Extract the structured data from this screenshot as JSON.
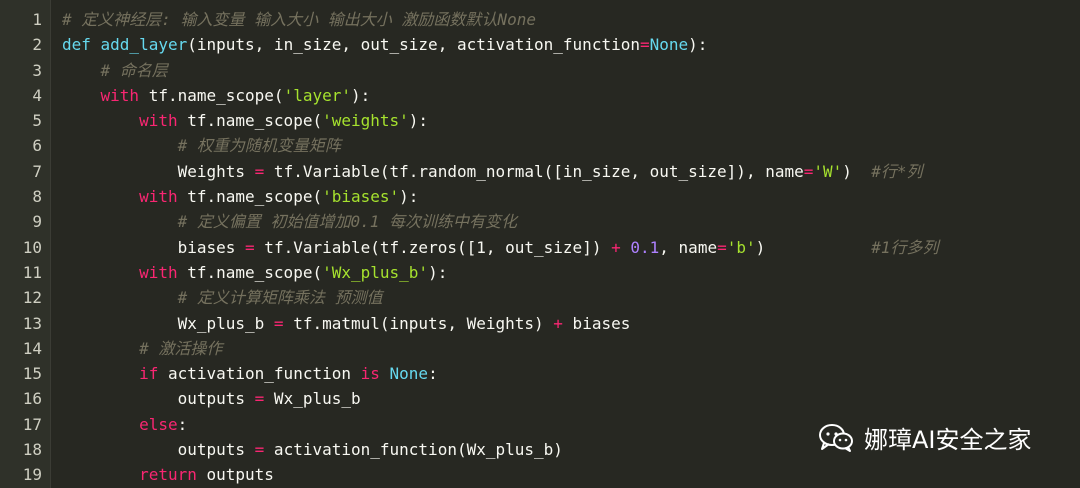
{
  "lines": [
    {
      "n": "1",
      "tokens": [
        {
          "c": "cmt",
          "t": "# 定义神经层: 输入变量 输入大小 输出大小 激励函数默认None"
        }
      ]
    },
    {
      "n": "2",
      "tokens": [
        {
          "c": "kw2",
          "t": "def "
        },
        {
          "c": "fn",
          "t": "add_layer"
        },
        {
          "c": "",
          "t": "(inputs, in_size, out_size, activation_function"
        },
        {
          "c": "op",
          "t": "="
        },
        {
          "c": "cst",
          "t": "None"
        },
        {
          "c": "",
          "t": "):"
        }
      ]
    },
    {
      "n": "3",
      "tokens": [
        {
          "c": "",
          "t": "    "
        },
        {
          "c": "cmt",
          "t": "# 命名层"
        }
      ]
    },
    {
      "n": "4",
      "tokens": [
        {
          "c": "",
          "t": "    "
        },
        {
          "c": "kw",
          "t": "with"
        },
        {
          "c": "",
          "t": " tf.name_scope("
        },
        {
          "c": "str",
          "t": "'layer'"
        },
        {
          "c": "",
          "t": "):"
        }
      ]
    },
    {
      "n": "5",
      "tokens": [
        {
          "c": "",
          "t": "        "
        },
        {
          "c": "kw",
          "t": "with"
        },
        {
          "c": "",
          "t": " tf.name_scope("
        },
        {
          "c": "str",
          "t": "'weights'"
        },
        {
          "c": "",
          "t": "):"
        }
      ]
    },
    {
      "n": "6",
      "tokens": [
        {
          "c": "",
          "t": "            "
        },
        {
          "c": "cmt",
          "t": "# 权重为随机变量矩阵"
        }
      ]
    },
    {
      "n": "7",
      "tokens": [
        {
          "c": "",
          "t": "            Weights "
        },
        {
          "c": "op",
          "t": "="
        },
        {
          "c": "",
          "t": " tf.Variable(tf.random_normal([in_size, out_size]), name"
        },
        {
          "c": "op",
          "t": "="
        },
        {
          "c": "str",
          "t": "'W'"
        },
        {
          "c": "",
          "t": ")  "
        },
        {
          "c": "cmt",
          "t": "#行*列"
        }
      ]
    },
    {
      "n": "8",
      "tokens": [
        {
          "c": "",
          "t": "        "
        },
        {
          "c": "kw",
          "t": "with"
        },
        {
          "c": "",
          "t": " tf.name_scope("
        },
        {
          "c": "str",
          "t": "'biases'"
        },
        {
          "c": "",
          "t": "):"
        }
      ]
    },
    {
      "n": "9",
      "tokens": [
        {
          "c": "",
          "t": "            "
        },
        {
          "c": "cmt",
          "t": "# 定义偏置 初始值增加0.1 每次训练中有变化"
        }
      ]
    },
    {
      "n": "10",
      "tokens": [
        {
          "c": "",
          "t": "            biases "
        },
        {
          "c": "op",
          "t": "="
        },
        {
          "c": "",
          "t": " tf.Variable(tf.zeros([1, out_size]) "
        },
        {
          "c": "op",
          "t": "+"
        },
        {
          "c": "",
          "t": " "
        },
        {
          "c": "num",
          "t": "0.1"
        },
        {
          "c": "",
          "t": ", name"
        },
        {
          "c": "op",
          "t": "="
        },
        {
          "c": "str",
          "t": "'b'"
        },
        {
          "c": "",
          "t": ")           "
        },
        {
          "c": "cmt",
          "t": "#1行多列"
        }
      ]
    },
    {
      "n": "11",
      "tokens": [
        {
          "c": "",
          "t": "        "
        },
        {
          "c": "kw",
          "t": "with"
        },
        {
          "c": "",
          "t": " tf.name_scope("
        },
        {
          "c": "str",
          "t": "'Wx_plus_b'"
        },
        {
          "c": "",
          "t": "):"
        }
      ]
    },
    {
      "n": "12",
      "tokens": [
        {
          "c": "",
          "t": "            "
        },
        {
          "c": "cmt",
          "t": "# 定义计算矩阵乘法 预测值"
        }
      ]
    },
    {
      "n": "13",
      "tokens": [
        {
          "c": "",
          "t": "            Wx_plus_b "
        },
        {
          "c": "op",
          "t": "="
        },
        {
          "c": "",
          "t": " tf.matmul(inputs, Weights) "
        },
        {
          "c": "op",
          "t": "+"
        },
        {
          "c": "",
          "t": " biases"
        }
      ]
    },
    {
      "n": "14",
      "tokens": [
        {
          "c": "",
          "t": "        "
        },
        {
          "c": "cmt",
          "t": "# 激活操作"
        }
      ]
    },
    {
      "n": "15",
      "tokens": [
        {
          "c": "",
          "t": "        "
        },
        {
          "c": "kw",
          "t": "if"
        },
        {
          "c": "",
          "t": " activation_function "
        },
        {
          "c": "kw",
          "t": "is"
        },
        {
          "c": "",
          "t": " "
        },
        {
          "c": "cst",
          "t": "None"
        },
        {
          "c": "",
          "t": ":"
        }
      ]
    },
    {
      "n": "16",
      "tokens": [
        {
          "c": "",
          "t": "            outputs "
        },
        {
          "c": "op",
          "t": "="
        },
        {
          "c": "",
          "t": " Wx_plus_b"
        }
      ]
    },
    {
      "n": "17",
      "tokens": [
        {
          "c": "",
          "t": "        "
        },
        {
          "c": "kw",
          "t": "else"
        },
        {
          "c": "",
          "t": ":"
        }
      ]
    },
    {
      "n": "18",
      "tokens": [
        {
          "c": "",
          "t": "            outputs "
        },
        {
          "c": "op",
          "t": "="
        },
        {
          "c": "",
          "t": " activation_function(Wx_plus_b)"
        }
      ]
    },
    {
      "n": "19",
      "tokens": [
        {
          "c": "",
          "t": "        "
        },
        {
          "c": "kw",
          "t": "return"
        },
        {
          "c": "",
          "t": " outputs"
        }
      ]
    }
  ],
  "watermark": {
    "text": "娜璋AI安全之家",
    "icon": "wechat-icon"
  },
  "colors": {
    "background": "#272822",
    "keyword": "#f92672",
    "function": "#66d9ef",
    "string": "#a6e22e",
    "number": "#ae81ff",
    "comment": "#75715e"
  }
}
